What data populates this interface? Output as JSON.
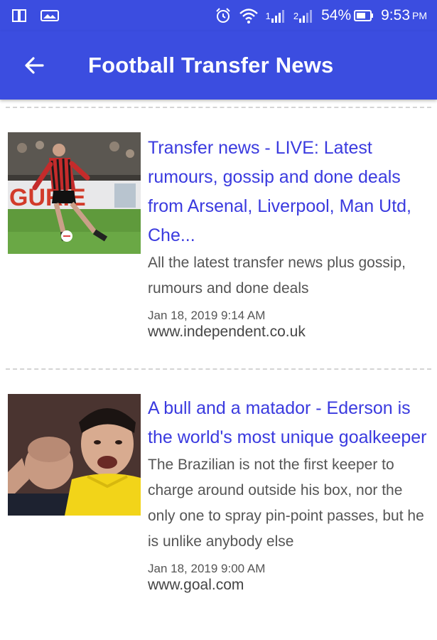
{
  "status_bar": {
    "battery": "54%",
    "time": "9:53",
    "ampm": "PM",
    "sim1": "1",
    "sim2": "2"
  },
  "app_bar": {
    "title": "Football Transfer News"
  },
  "articles": [
    {
      "headline": "Transfer news - LIVE: Latest rumours, gossip and done deals from Arsenal, Liverpool, Man Utd, Che...",
      "summary": "All the latest transfer news plus gossip, rumours and done deals",
      "date": "Jan 18, 2019 9:14 AM",
      "source": "www.independent.co.uk",
      "thumbnail_text": "GURIE"
    },
    {
      "headline": "A bull and a matador - Ederson is the world's most unique goalkeeper",
      "summary": "The Brazilian is not the first keeper to charge around outside his box, nor the only one to spray pin-point passes, but he is unlike anybody else",
      "date": "Jan 18, 2019 9:00 AM",
      "source": "www.goal.com"
    }
  ]
}
